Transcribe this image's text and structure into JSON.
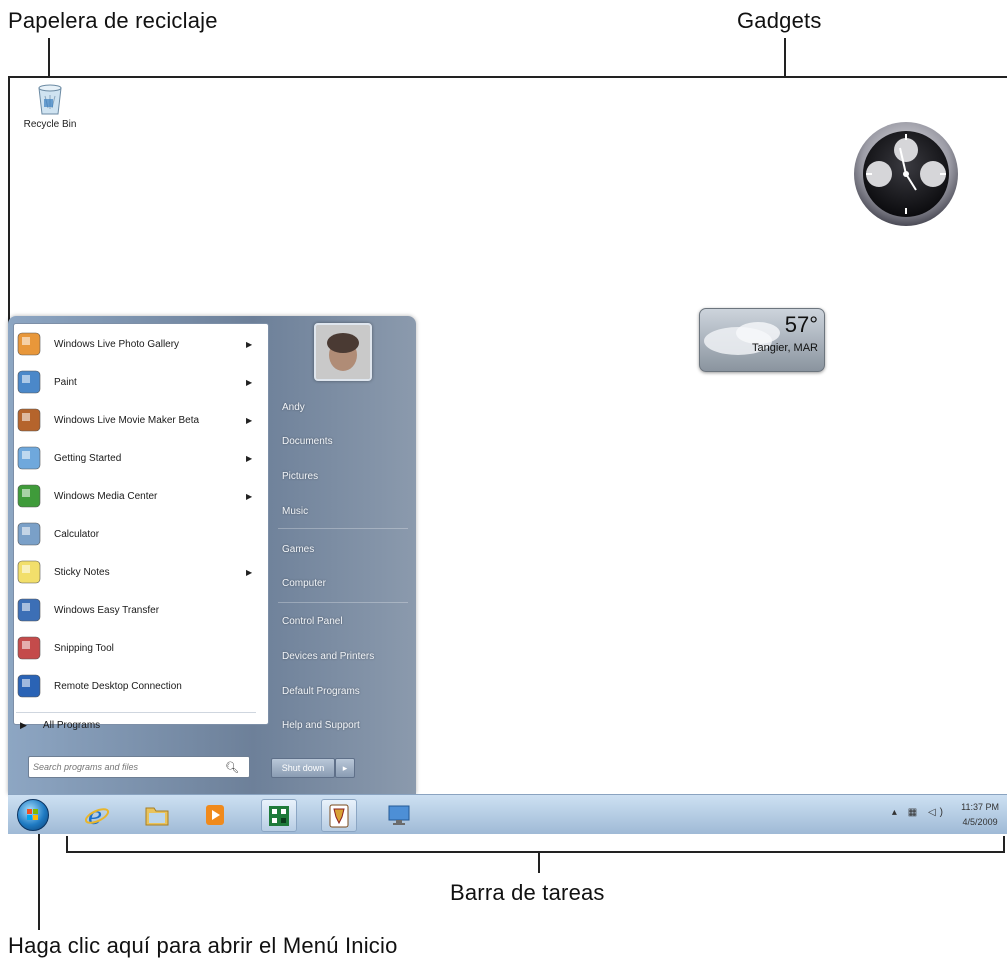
{
  "callouts": {
    "recycle_bin": "Papelera de reciclaje",
    "gadgets": "Gadgets",
    "taskbar": "Barra de tareas",
    "start_menu": "Haga clic aquí para abrir el Menú Inicio"
  },
  "desktop": {
    "recycle_bin_label": "Recycle Bin"
  },
  "weather": {
    "temperature": "57°",
    "location": "Tangier, MAR"
  },
  "start_menu": {
    "programs": [
      {
        "label": "Windows Live Photo Gallery",
        "icon": "photo-gallery-icon",
        "submenu": true
      },
      {
        "label": "Paint",
        "icon": "paint-icon",
        "submenu": true
      },
      {
        "label": "Windows Live Movie Maker Beta",
        "icon": "movie-maker-icon",
        "submenu": true
      },
      {
        "label": "Getting Started",
        "icon": "getting-started-icon",
        "submenu": true
      },
      {
        "label": "Windows Media Center",
        "icon": "media-center-icon",
        "submenu": true
      },
      {
        "label": "Calculator",
        "icon": "calculator-icon",
        "submenu": false
      },
      {
        "label": "Sticky Notes",
        "icon": "sticky-notes-icon",
        "submenu": true
      },
      {
        "label": "Windows Easy Transfer",
        "icon": "easy-transfer-icon",
        "submenu": false
      },
      {
        "label": "Snipping Tool",
        "icon": "snipping-tool-icon",
        "submenu": false
      },
      {
        "label": "Remote Desktop Connection",
        "icon": "remote-desktop-icon",
        "submenu": false
      }
    ],
    "all_programs": "All Programs",
    "search_placeholder": "Search programs and files",
    "right_links": [
      "Andy",
      "Documents",
      "Pictures",
      "Music",
      "Games",
      "Computer",
      "Control Panel",
      "Devices and Printers",
      "Default Programs",
      "Help and Support"
    ],
    "shutdown_label": "Shut down"
  },
  "taskbar": {
    "items": [
      "internet-explorer-icon",
      "windows-explorer-icon",
      "media-player-icon",
      "game-icon",
      "solitaire-icon",
      "remote-desktop-icon"
    ],
    "time": "11:37 PM",
    "date": "4/5/2009"
  }
}
